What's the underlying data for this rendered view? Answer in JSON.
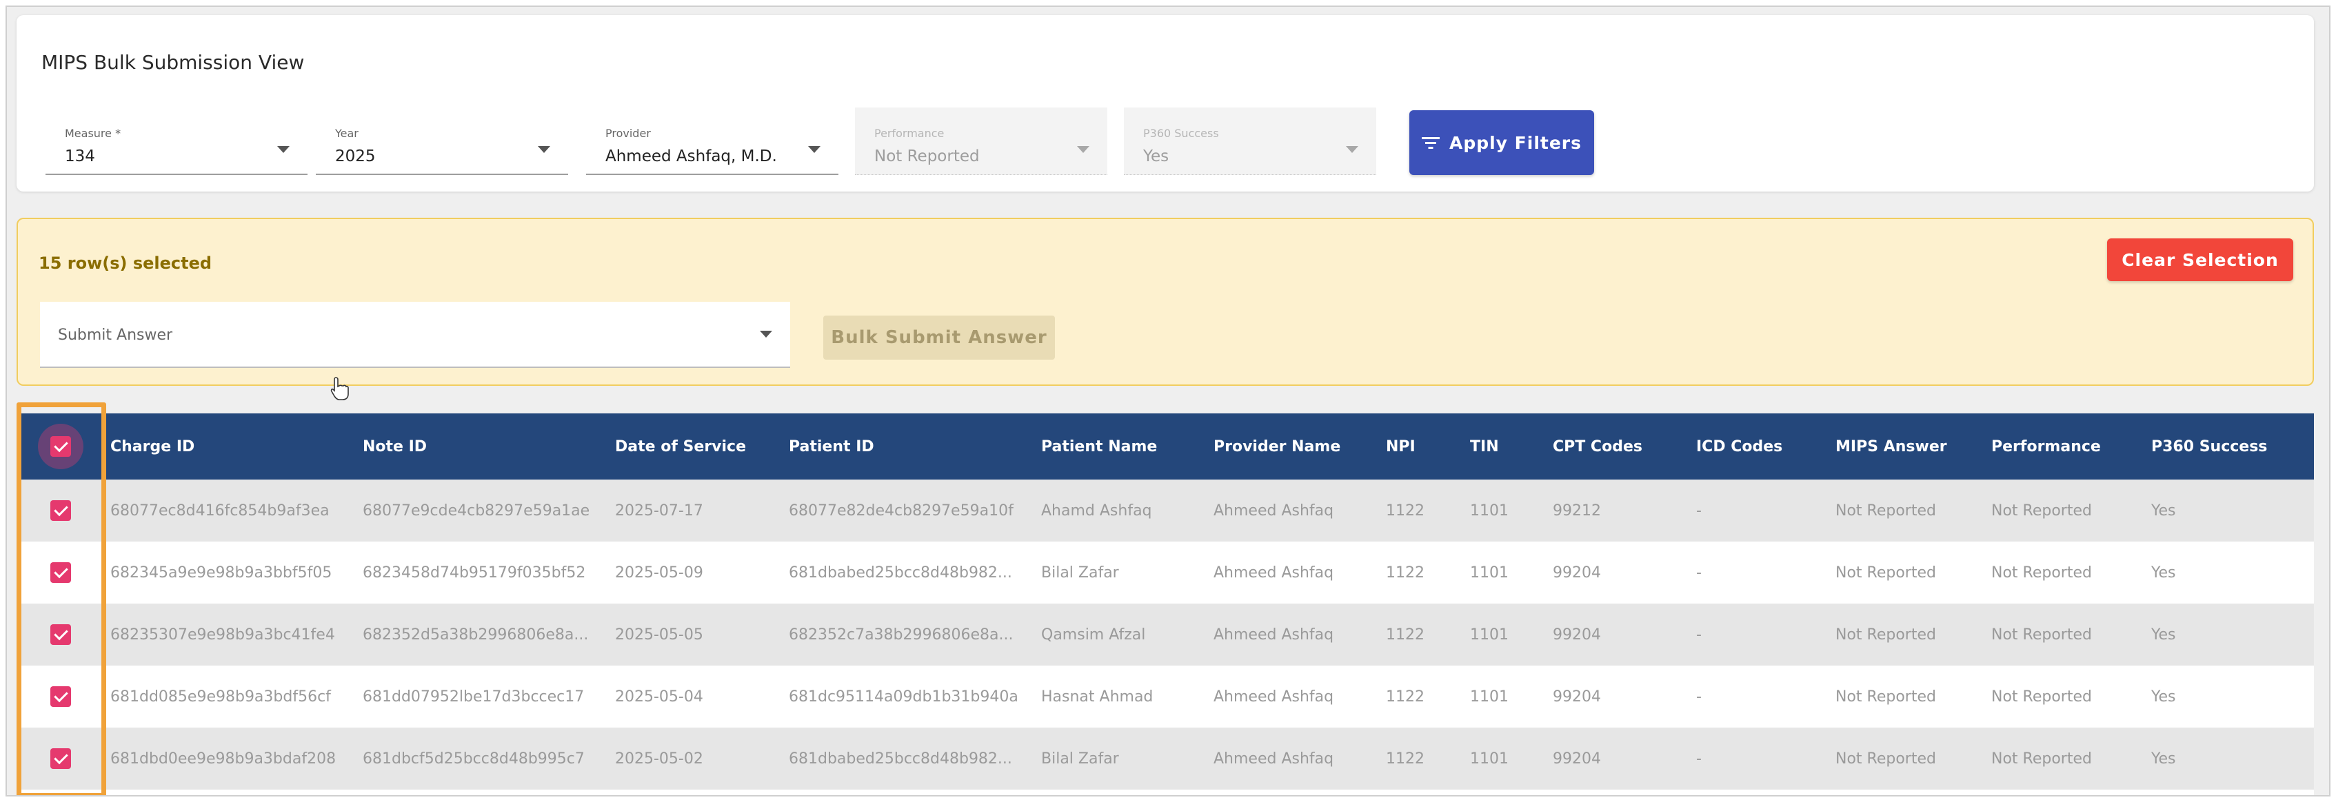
{
  "page_title": "MIPS Bulk Submission View",
  "filters": {
    "measure": {
      "label": "Measure *",
      "value": "134"
    },
    "year": {
      "label": "Year",
      "value": "2025"
    },
    "provider": {
      "label": "Provider",
      "value": "Ahmeed Ashfaq, M.D."
    },
    "performance": {
      "label": "Performance",
      "value": "Not Reported"
    },
    "p360_success": {
      "label": "P360 Success",
      "value": "Yes"
    },
    "apply_label": "Apply Filters"
  },
  "selection": {
    "count_text": "15 row(s) selected",
    "clear_label": "Clear Selection",
    "answer_placeholder": "Submit Answer",
    "bulk_label": "Bulk Submit Answer"
  },
  "table": {
    "columns": [
      "Charge ID",
      "Note ID",
      "Date of Service",
      "Patient ID",
      "Patient Name",
      "Provider Name",
      "NPI",
      "TIN",
      "CPT Codes",
      "ICD Codes",
      "MIPS Answer",
      "Performance",
      "P360 Success"
    ],
    "rows": [
      {
        "charge_id": "68077ec8d416fc854b9af3ea",
        "note_id": "68077e9cde4cb8297e59a1ae",
        "date": "2025-07-17",
        "patient_id": "68077e82de4cb8297e59a10f",
        "patient_name": "Ahamd Ashfaq",
        "provider_name": "Ahmeed Ashfaq",
        "npi": "1122",
        "tin": "1101",
        "cpt": "99212",
        "icd": "-",
        "mips_answer": "Not Reported",
        "performance": "Not Reported",
        "p360": "Yes"
      },
      {
        "charge_id": "682345a9e9e98b9a3bbf5f05",
        "note_id": "6823458d74b95179f035bf52",
        "date": "2025-05-09",
        "patient_id": "681dbabed25bcc8d48b982...",
        "patient_name": "Bilal Zafar",
        "provider_name": "Ahmeed Ashfaq",
        "npi": "1122",
        "tin": "1101",
        "cpt": "99204",
        "icd": "-",
        "mips_answer": "Not Reported",
        "performance": "Not Reported",
        "p360": "Yes"
      },
      {
        "charge_id": "68235307e9e98b9a3bc41fe4",
        "note_id": "682352d5a38b2996806e8a...",
        "date": "2025-05-05",
        "patient_id": "682352c7a38b2996806e8a...",
        "patient_name": "Qamsim Afzal",
        "provider_name": "Ahmeed Ashfaq",
        "npi": "1122",
        "tin": "1101",
        "cpt": "99204",
        "icd": "-",
        "mips_answer": "Not Reported",
        "performance": "Not Reported",
        "p360": "Yes"
      },
      {
        "charge_id": "681dd085e9e98b9a3bdf56cf",
        "note_id": "681dd07952lbe17d3bccec17",
        "date": "2025-05-04",
        "patient_id": "681dc95114a09db1b31b940a",
        "patient_name": "Hasnat Ahmad",
        "provider_name": "Ahmeed Ashfaq",
        "npi": "1122",
        "tin": "1101",
        "cpt": "99204",
        "icd": "-",
        "mips_answer": "Not Reported",
        "performance": "Not Reported",
        "p360": "Yes"
      },
      {
        "charge_id": "681dbd0ee9e98b9a3bdaf208",
        "note_id": "681dbcf5d25bcc8d48b995c7",
        "date": "2025-05-02",
        "patient_id": "681dbabed25bcc8d48b982...",
        "patient_name": "Bilal Zafar",
        "provider_name": "Ahmeed Ashfaq",
        "npi": "1122",
        "tin": "1101",
        "cpt": "99204",
        "icd": "-",
        "mips_answer": "Not Reported",
        "performance": "Not Reported",
        "p360": "Yes"
      }
    ]
  },
  "colors": {
    "header_bg": "#24477b",
    "apply_bg": "#3c51b9",
    "clear_bg": "#f2463a",
    "banner_bg": "#fdf1cf",
    "checkbox": "#e5396e",
    "highlight": "#f0a23a"
  }
}
